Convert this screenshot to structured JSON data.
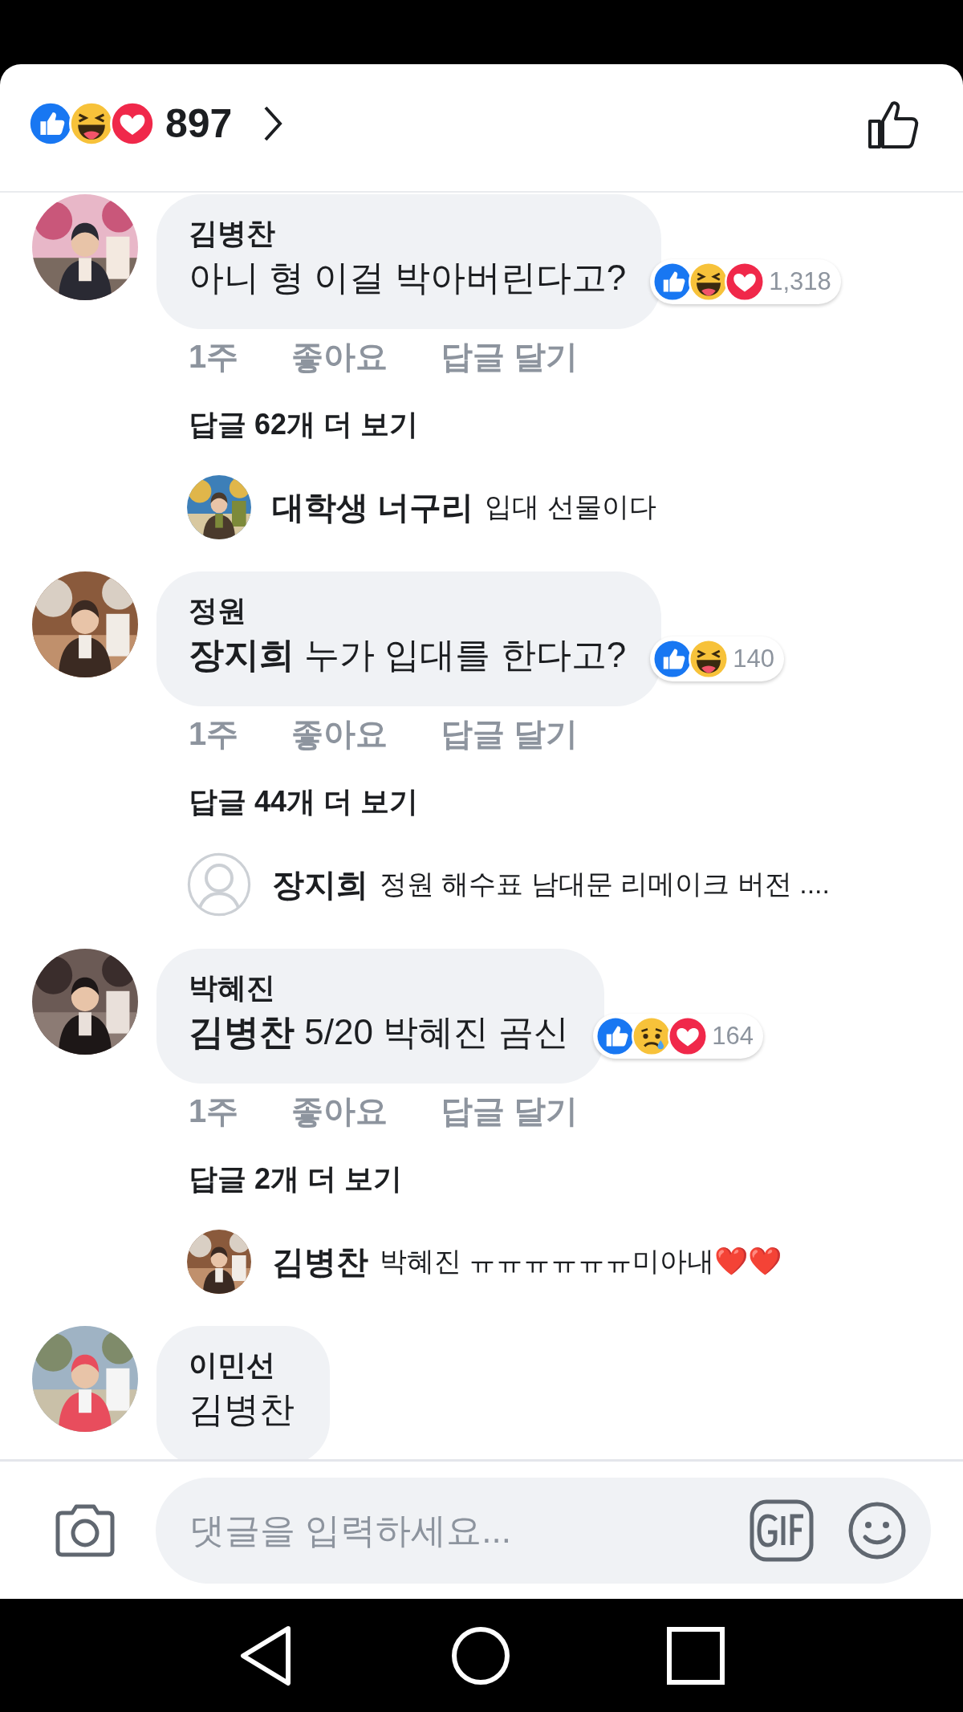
{
  "header": {
    "reactions": [
      {
        "kind": "like"
      },
      {
        "kind": "haha"
      },
      {
        "kind": "love"
      }
    ],
    "count": "897"
  },
  "comments": [
    {
      "author": "김병찬",
      "text": "아니 형 이걸 박아버린다고?",
      "reactions": {
        "kinds": [
          {
            "kind": "like"
          },
          {
            "kind": "haha"
          },
          {
            "kind": "love"
          }
        ],
        "count": "1,318"
      },
      "time": "1주",
      "like_label": "좋아요",
      "reply_label": "답글 달기",
      "more_replies": "답글 62개 더 보기",
      "reply": {
        "author": "대학생 너구리",
        "text": "입대 선물이다"
      }
    },
    {
      "author": "정원",
      "text": "**장지희** 누가 입대를 한다고?",
      "reactions": {
        "kinds": [
          {
            "kind": "like"
          },
          {
            "kind": "haha"
          }
        ],
        "count": "140"
      },
      "time": "1주",
      "like_label": "좋아요",
      "reply_label": "답글 달기",
      "more_replies": "답글 44개 더 보기",
      "reply": {
        "author": "장지희",
        "text": "정원 해수표 남대문 리메이크 버전 ....",
        "avatar": {
          "kind": "default"
        }
      }
    },
    {
      "author": "박혜진",
      "text": "**김병찬** 5/20 박혜진 곰신",
      "reactions": {
        "kinds": [
          {
            "kind": "like"
          },
          {
            "kind": "sad"
          },
          {
            "kind": "love"
          }
        ],
        "count": "164"
      },
      "time": "1주",
      "like_label": "좋아요",
      "reply_label": "답글 달기",
      "more_replies": "답글 2개 더 보기",
      "reply": {
        "author": "김병찬",
        "text": "박혜진 ㅠㅠㅠㅠㅠㅠ미아내❤️❤️"
      }
    },
    {
      "author": "이민선",
      "text": "김병찬"
    }
  ],
  "composer": {
    "placeholder": "댓글을 입력하세요..."
  }
}
